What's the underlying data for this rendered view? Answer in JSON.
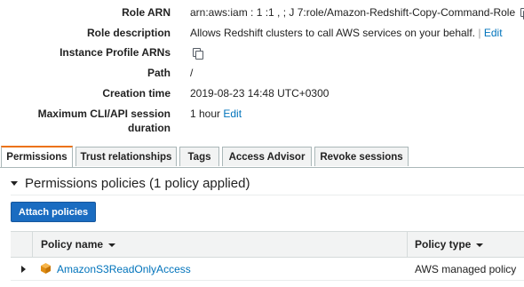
{
  "summary": {
    "role_arn": {
      "label": "Role ARN",
      "value": "arn:aws:iam  :  1   :1  ,  ;  J  7:role/Amazon-Redshift-Copy-Command-Role"
    },
    "role_description": {
      "label": "Role description",
      "value": "Allows Redshift clusters to call AWS services on your behalf.",
      "separator": "|",
      "edit_label": "Edit"
    },
    "instance_profile_arns": {
      "label": "Instance Profile ARNs"
    },
    "path": {
      "label": "Path",
      "value": "/"
    },
    "creation_time": {
      "label": "Creation time",
      "value": "2019-08-23 14:48 UTC+0300"
    },
    "max_session": {
      "label_line1": "Maximum CLI/API session",
      "label_line2": "duration",
      "value": "1 hour",
      "edit_label": "Edit"
    }
  },
  "tabs": [
    {
      "label": "Permissions",
      "active": true
    },
    {
      "label": "Trust relationships",
      "active": false
    },
    {
      "label": "Tags",
      "active": false
    },
    {
      "label": "Access Advisor",
      "active": false
    },
    {
      "label": "Revoke sessions",
      "active": false
    }
  ],
  "permissions": {
    "section_title": "Permissions policies (1 policy applied)",
    "attach_button": "Attach policies",
    "table": {
      "columns": [
        "Policy name",
        "Policy type"
      ],
      "rows": [
        {
          "policy_name": "AmazonS3ReadOnlyAccess",
          "policy_type": "AWS managed policy"
        }
      ]
    }
  },
  "icons": {
    "copy": "copy-icon",
    "policy": "policy-cube-icon",
    "expand": "caret-right-icon",
    "collapse": "caret-down-icon",
    "sort": "sort-caret-icon"
  },
  "colors": {
    "link": "#0073bb",
    "primary_button": "#1a6cc1",
    "active_tab_accent": "#ec7211",
    "table_header_bg": "#f2f3f3",
    "policy_icon": "#ec9d1c"
  }
}
